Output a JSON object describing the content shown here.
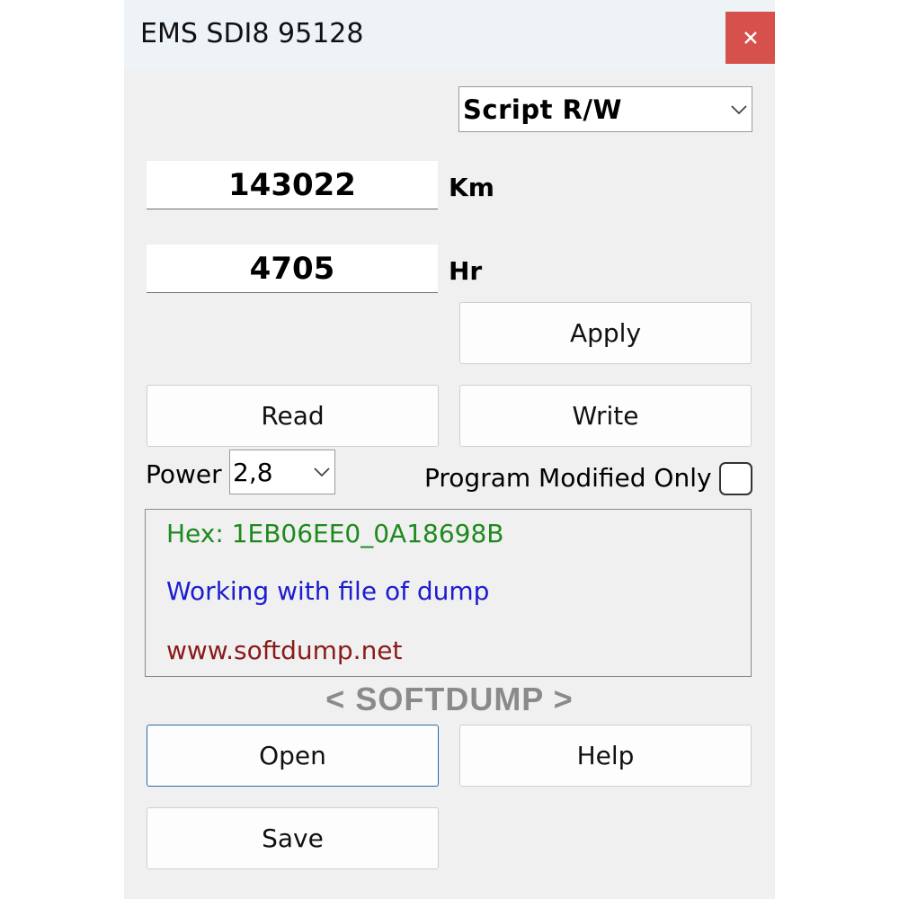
{
  "window": {
    "title": "EMS SDI8 95128"
  },
  "controls": {
    "mode_select": {
      "value": "Script R/W"
    },
    "km": {
      "value": "143022",
      "unit": "Km"
    },
    "hr": {
      "value": "4705",
      "unit": "Hr"
    },
    "apply_label": "Apply",
    "read_label": "Read",
    "write_label": "Write",
    "power": {
      "label": "Power",
      "value": "2,8"
    },
    "program_modified_only": {
      "label": "Program Modified Only",
      "checked": false
    }
  },
  "log": {
    "hex": "Hex: 1EB06EE0_0A18698B",
    "working": "Working with file of dump",
    "website": "www.softdump.net"
  },
  "brand": "< SOFTDUMP >",
  "buttons": {
    "open_label": "Open",
    "help_label": "Help",
    "save_label": "Save"
  },
  "colors": {
    "close_button": "#d6504c",
    "log_hex": "#1e8a1e",
    "log_working": "#1c1cd0",
    "log_website": "#8b1a1a",
    "brand": "#8a8a8a"
  },
  "icons": {
    "close": "close-icon",
    "dropdown": "chevron-down-icon"
  }
}
